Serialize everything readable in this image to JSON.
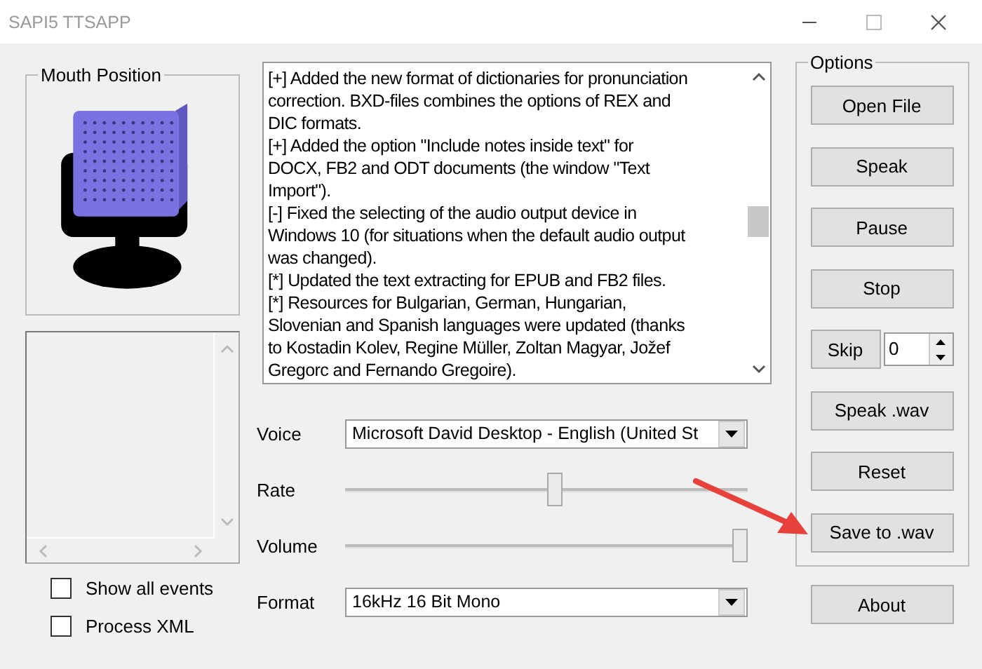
{
  "window": {
    "title": "SAPI5 TTSAPP"
  },
  "mouth_position": {
    "label": "Mouth Position"
  },
  "checkboxes": [
    {
      "label": "Show all events",
      "checked": false
    },
    {
      "label": "Process XML",
      "checked": false
    }
  ],
  "text_lines": [
    "[+] Added the new format of dictionaries for pronunciation",
    "correction. BXD-files combines the options of REX and",
    "DIC formats.",
    "[+] Added the option \"Include notes inside text\" for",
    "DOCX, FB2 and ODT documents (the window \"Text",
    "Import\").",
    "[-] Fixed the selecting of the audio output device in",
    "Windows 10 (for situations when the default audio output",
    "was changed).",
    "[*] Updated the text extracting for EPUB and FB2 files.",
    "[*] Resources for Bulgarian, German, Hungarian,",
    "Slovenian and Spanish languages were updated (thanks",
    "to Kostadin Kolev, Regine Müller, Zoltan Magyar, Jožef",
    "Gregorc and Fernando Gregoire)."
  ],
  "controls": [
    {
      "kind": "dropdown",
      "label": "Voice",
      "value": "Microsoft David Desktop - English (United St"
    },
    {
      "kind": "slider",
      "label": "Rate",
      "level": 0.52
    },
    {
      "kind": "slider",
      "label": "Volume",
      "level": 1.0
    },
    {
      "kind": "dropdown",
      "label": "Format",
      "value": "16kHz 16 Bit Mono"
    }
  ],
  "options": {
    "label": "Options",
    "buttons": [
      {
        "kind": "button",
        "label": "Open File"
      },
      {
        "kind": "button",
        "label": "Speak"
      },
      {
        "kind": "button",
        "label": "Pause"
      },
      {
        "kind": "button",
        "label": "Stop"
      },
      {
        "kind": "skip",
        "label": "Skip",
        "value": "0"
      },
      {
        "kind": "button",
        "label": "Speak .wav"
      },
      {
        "kind": "button",
        "label": "Reset"
      },
      {
        "kind": "button",
        "label": "Save to .wav"
      }
    ]
  },
  "about_button": "About"
}
